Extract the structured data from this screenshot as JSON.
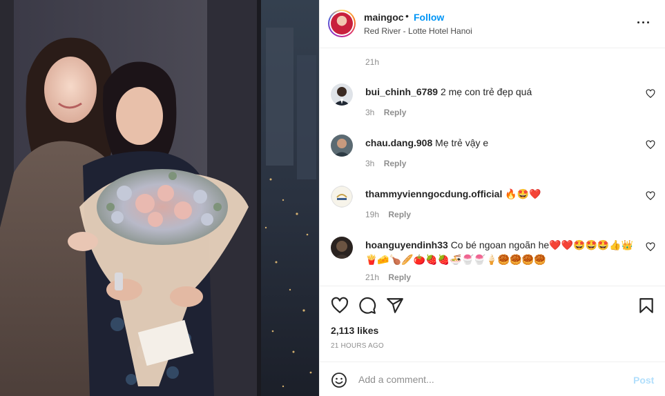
{
  "post": {
    "username": "maingoc",
    "separator": "•",
    "follow_label": "Follow",
    "location": "Red River - Lotte Hotel Hanoi",
    "caption_time": "21h"
  },
  "comments": [
    {
      "username": "bui_chinh_6789",
      "text": "2 mẹ con trẻ đẹp quá",
      "time": "3h",
      "reply": "Reply"
    },
    {
      "username": "chau.dang.908",
      "text": "Mẹ trẻ vậy e",
      "time": "3h",
      "reply": "Reply"
    },
    {
      "username": "thammyvienngocdung.official",
      "text": "🔥🤩❤️",
      "time": "19h",
      "reply": "Reply"
    },
    {
      "username": "hoanguyendinh33",
      "text": "Co bé ngoan ngoãn he❤️❤️🤩🤩🤩👍👑🍟🧀🍗🥖🍅🍓🍓🍜🍧🍧🍦🥮🥮🥮🥮",
      "time": "21h",
      "reply": "Reply"
    }
  ],
  "engagement": {
    "likes": "2,113 likes",
    "posted": "21 HOURS AGO"
  },
  "composer": {
    "placeholder": "Add a comment...",
    "post_label": "Post"
  },
  "icons": {
    "more": "more-options-icon",
    "heart": "heart-icon",
    "comment": "comment-icon",
    "share": "share-icon",
    "save": "bookmark-icon",
    "emoji": "emoji-icon"
  },
  "colors": {
    "link_blue": "#0095f6",
    "post_disabled": "#b2dffc",
    "secondary_text": "#8e8e8e",
    "primary_text": "#262626"
  }
}
